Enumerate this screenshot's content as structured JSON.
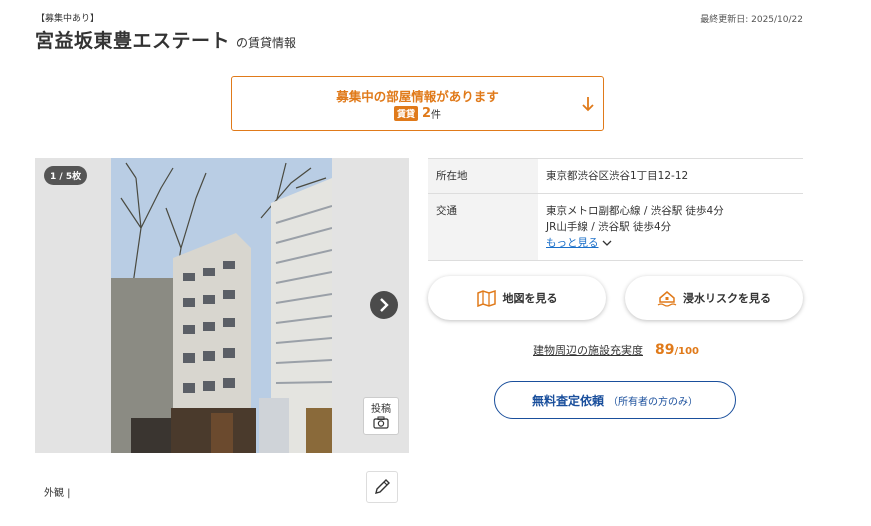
{
  "header": {
    "status_tag": "【募集中あり】",
    "title": "宮益坂東豊エステート",
    "title_suffix": "の賃貸情報",
    "updated": "最終更新日: 2025/10/22"
  },
  "vacancy": {
    "title": "募集中の部屋情報があります",
    "badge": "賃貸",
    "count": "2",
    "unit": "件",
    "icon": "arrow-down-icon"
  },
  "gallery": {
    "counter": "1 / 5枚",
    "post_label": "投稿",
    "caption": "外観 |",
    "icons": [
      "chevron-right-icon",
      "camera-icon",
      "pencil-icon"
    ]
  },
  "info": {
    "rows": [
      {
        "label": "所在地",
        "lines": [
          "東京都渋谷区渋谷1丁目12-12"
        ]
      },
      {
        "label": "交通",
        "lines": [
          "東京メトロ副都心線 / 渋谷駅 徒歩4分",
          "JR山手線 / 渋谷駅 徒歩4分"
        ]
      }
    ],
    "more_link": "もっと見る"
  },
  "actions": {
    "map": "地図を見る",
    "flood": "浸水リスクを見る"
  },
  "facility": {
    "label": "建物周辺の施設充実度",
    "score": "89",
    "score_max": "/100"
  },
  "appraisal": {
    "label": "無料査定依頼",
    "note": "（所有者の方のみ）"
  },
  "colors": {
    "accent_orange": "#e07a1a",
    "link_blue": "#1a6fc9",
    "button_navy": "#1a4f9c"
  }
}
